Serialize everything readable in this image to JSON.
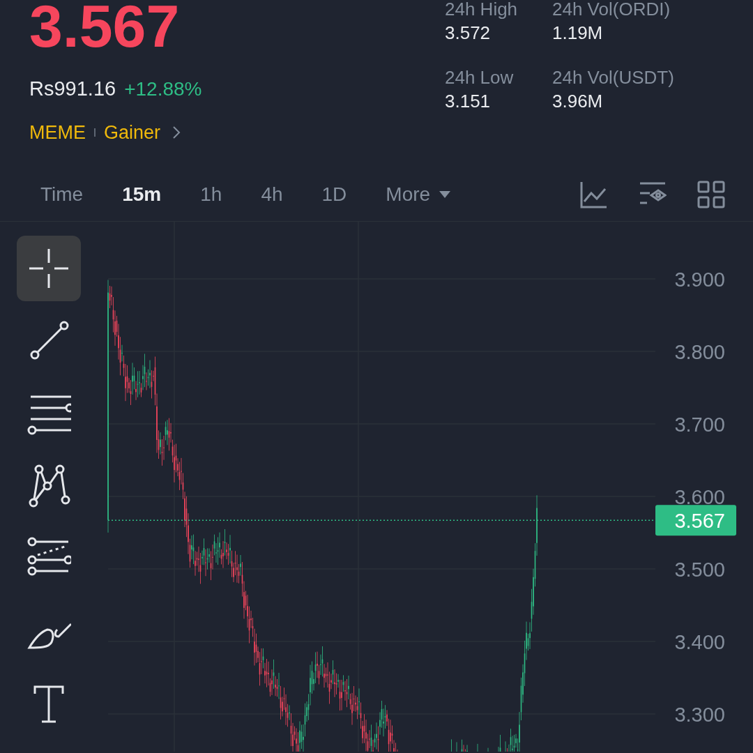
{
  "header": {
    "price": "3.567",
    "fiat_price": "Rs991.16",
    "change": "+12.88%",
    "tags": [
      "MEME",
      "Gainer"
    ]
  },
  "stats": [
    {
      "label": "24h High",
      "value": "3.572"
    },
    {
      "label": "24h Vol(ORDI)",
      "value": "1.19M"
    },
    {
      "label": "24h Low",
      "value": "3.151"
    },
    {
      "label": "24h Vol(USDT)",
      "value": "3.96M"
    }
  ],
  "intervals": [
    {
      "label": "Time",
      "selected": false
    },
    {
      "label": "15m",
      "selected": true
    },
    {
      "label": "1h",
      "selected": false
    },
    {
      "label": "4h",
      "selected": false
    },
    {
      "label": "1D",
      "selected": false
    }
  ],
  "more": {
    "label": "More"
  },
  "tools": [
    {
      "kind": "crosshair",
      "selected": true
    },
    {
      "kind": "trendline",
      "selected": false
    },
    {
      "kind": "hlines",
      "selected": false
    },
    {
      "kind": "pattern",
      "selected": false
    },
    {
      "kind": "fib",
      "selected": false
    },
    {
      "kind": "brush",
      "selected": false
    },
    {
      "kind": "text",
      "selected": false
    }
  ],
  "chart": {
    "price_axis": [
      "3.900",
      "3.800",
      "3.700",
      "3.600",
      "3.500",
      "3.400",
      "3.300"
    ],
    "last_price": "3.567"
  }
}
